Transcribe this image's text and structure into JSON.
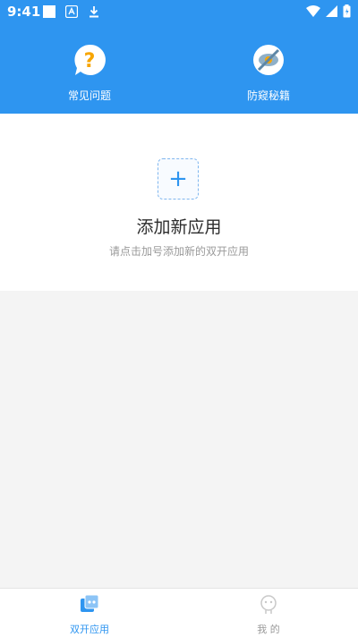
{
  "status_bar": {
    "time": "9:41"
  },
  "header": {
    "faq": {
      "label": "常见问题",
      "icon": "question-icon"
    },
    "anti_spy": {
      "label": "防窥秘籍",
      "icon": "eye-shield-icon"
    }
  },
  "add_card": {
    "plus": "+",
    "title": "添加新应用",
    "subtitle": "请点击加号添加新的双开应用"
  },
  "tabs": [
    {
      "label": "双开应用",
      "active": true,
      "icon": "dual-apps-icon"
    },
    {
      "label": "我 的",
      "active": false,
      "icon": "profile-icon"
    }
  ],
  "colors": {
    "primary": "#2e95f0",
    "accent_orange": "#f7a500",
    "inactive": "#9a9a9a"
  }
}
